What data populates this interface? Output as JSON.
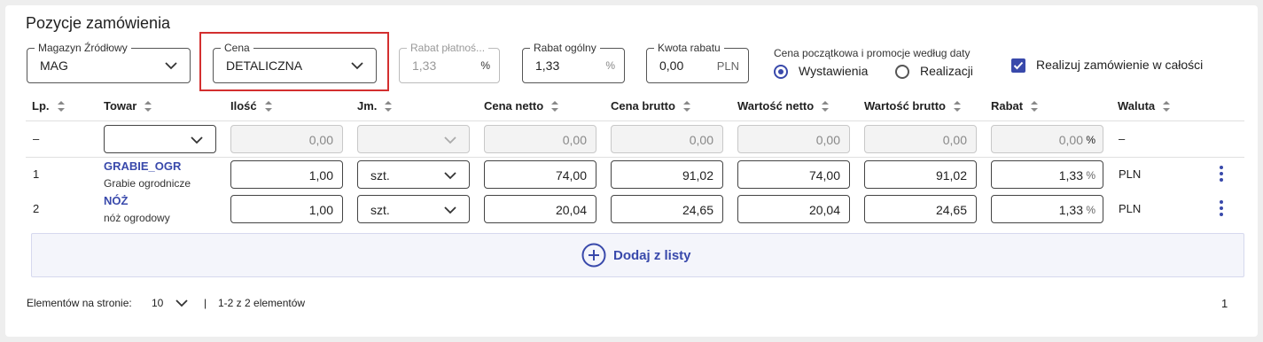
{
  "section_title": "Pozycje zamówienia",
  "filters": {
    "warehouse": {
      "label": "Magazyn Źródłowy",
      "value": "MAG"
    },
    "price": {
      "label": "Cena",
      "value": "DETALICZNA"
    },
    "payment_discount": {
      "label": "Rabat płatnoś...",
      "value": "1,33",
      "suffix": "%"
    },
    "general_discount": {
      "label": "Rabat ogólny",
      "value": "1,33",
      "suffix": "%"
    },
    "discount_amount": {
      "label": "Kwota rabatu",
      "value": "0,00",
      "suffix": "PLN"
    },
    "date_group": {
      "label": "Cena początkowa i promocje według daty",
      "options": [
        {
          "label": "Wystawienia",
          "selected": true
        },
        {
          "label": "Realizacji",
          "selected": false
        }
      ]
    },
    "realize_all": {
      "label": "Realizuj zamówienie w całości",
      "checked": true
    }
  },
  "columns": [
    "Lp.",
    "Towar",
    "Ilość",
    "Jm.",
    "Cena netto",
    "Cena brutto",
    "Wartość netto",
    "Wartość brutto",
    "Rabat",
    "Waluta"
  ],
  "new_row": {
    "lp": "–",
    "qty": "0,00",
    "net_price": "0,00",
    "gross_price": "0,00",
    "net_value": "0,00",
    "gross_value": "0,00",
    "discount": "0,00",
    "discount_suffix": "%",
    "currency": "–"
  },
  "rows": [
    {
      "lp": "1",
      "code": "GRABIE_OGR",
      "name": "Grabie ogrodnicze",
      "qty": "1,00",
      "unit": "szt.",
      "net_price": "74,00",
      "gross_price": "91,02",
      "net_value": "74,00",
      "gross_value": "91,02",
      "discount": "1,33",
      "discount_suffix": "%",
      "currency": "PLN"
    },
    {
      "lp": "2",
      "code": "NÓŻ",
      "name": "nóż ogrodowy",
      "qty": "1,00",
      "unit": "szt.",
      "net_price": "20,04",
      "gross_price": "24,65",
      "net_value": "20,04",
      "gross_value": "24,65",
      "discount": "1,33",
      "discount_suffix": "%",
      "currency": "PLN"
    }
  ],
  "add_button": "Dodaj z listy",
  "pagination": {
    "per_page_label": "Elementów na stronie:",
    "per_page_value": "10",
    "separator": "|",
    "range": "1-2 z 2 elementów",
    "page": "1"
  },
  "colors": {
    "accent": "#3949ab",
    "highlight": "#d32f2f"
  }
}
